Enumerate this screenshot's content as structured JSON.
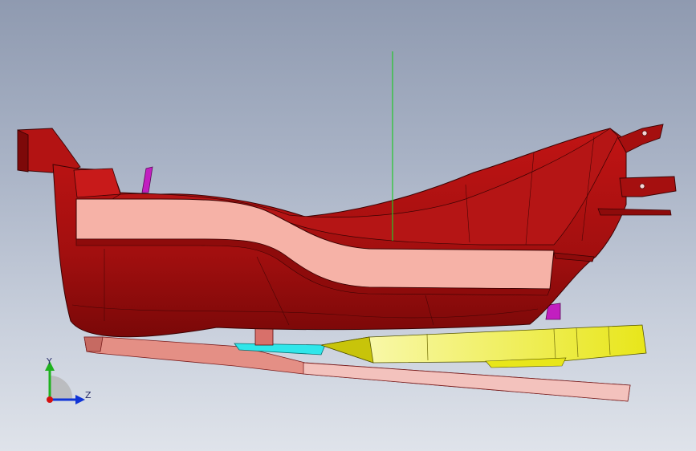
{
  "scene": {
    "background_top": "#8f9ab0",
    "background_bottom": "#dfe3ea",
    "part_color": "#a50f0f",
    "part_highlight": "#f6b2a7",
    "flange_color": "#e9958a",
    "yellow_part": "#ecec20",
    "cyan_part": "#2fe6ea",
    "magenta_part": "#c21ec0",
    "pink_part": "#e7a1a1",
    "guide_line_color": "#23c82b"
  },
  "triad": {
    "y_label": "Y",
    "z_label": "Z",
    "y_color": "#1fb21f",
    "z_color": "#1034d6",
    "origin_color": "#d41010"
  }
}
